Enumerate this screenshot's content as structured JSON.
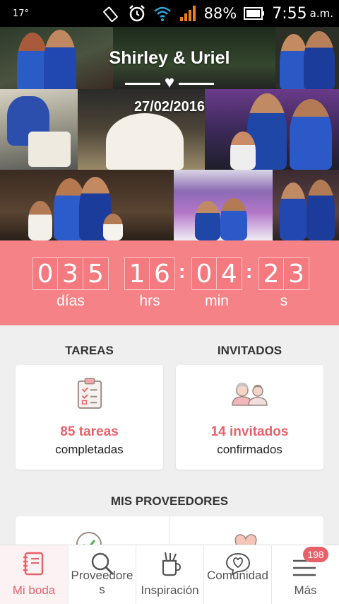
{
  "status_bar": {
    "temperature": "17°",
    "battery_percent": "88%",
    "time": "7:55",
    "ampm": "a.m."
  },
  "header": {
    "couple_names": "Shirley & Uriel",
    "wedding_date": "27/02/2016"
  },
  "countdown": {
    "days_digits": [
      "0",
      "3",
      "5"
    ],
    "hours_digits": [
      "1",
      "6"
    ],
    "minutes_digits": [
      "0",
      "4"
    ],
    "seconds_digits": [
      "2",
      "3"
    ],
    "days_label": "días",
    "hours_label": "hrs",
    "minutes_label": "min",
    "seconds_label": "s",
    "separator": ":"
  },
  "tasks": {
    "title": "TAREAS",
    "count_text": "85 tareas",
    "sub_text": "completadas",
    "icon": "clipboard-checklist-icon"
  },
  "guests": {
    "title": "INVITADOS",
    "count_text": "14 invitados",
    "sub_text": "confirmados",
    "icon": "couple-guests-icon"
  },
  "vendors": {
    "title": "MIS PROVEEDORES"
  },
  "bottom_nav": {
    "items": [
      {
        "label": "Mi boda",
        "icon": "notebook-icon",
        "active": true
      },
      {
        "label": "Proveedores",
        "icon": "magnifier-icon",
        "active": false
      },
      {
        "label": "Inspiración",
        "icon": "brushes-cup-icon",
        "active": false
      },
      {
        "label": "Comunidad",
        "icon": "heart-chat-icon",
        "active": false
      },
      {
        "label": "Más",
        "icon": "hamburger-menu-icon",
        "active": false,
        "badge": "198"
      }
    ]
  },
  "colors": {
    "accent": "#e8616a",
    "countdown_bg": "#f58287",
    "background": "#efefef"
  }
}
